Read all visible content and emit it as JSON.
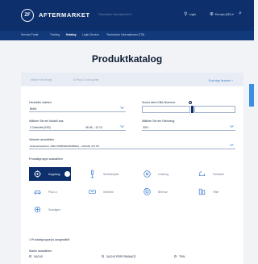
{
  "header": {
    "logo_text": "ZF",
    "brand": "AFTERMARKET",
    "dropdown": "Technische Informationen ▾",
    "login": "Login",
    "region": "Europa (DE) ▾"
  },
  "nav": {
    "items": [
      "Service-Portal",
      "Training",
      "Katalog",
      "Login-Service",
      "Technische Informationen (TIS)"
    ]
  },
  "page": {
    "title": "Produktkatalog"
  },
  "vehicle_bar": {
    "label1": "Meine Fahrzeuge",
    "label2": "⊟ Pkw & Transporter",
    "action": "Suchtyp ändern ›"
  },
  "form": {
    "manufacturer_label": "Hersteller wählen",
    "manufacturer_value": "BMW",
    "kba_label": "Suche über KBA-Nummer",
    "kba_info": "i",
    "model_label": "Wählen Sie ein Modell aus",
    "model_value": "3 Cabriolet (E93)",
    "model_years": "06.06 – 12.13",
    "vehicle_label": "Wählen Sie ein Fahrzeug",
    "vehicle_value": "330 i",
    "variant_label": "Variante auswählen",
    "variant_value": "Hinterachsantrieb, 1960 (N53B30A/N52B30A) – 200 kW, 272 PS",
    "group_label": "Produktgruppe auswählen"
  },
  "groups": [
    {
      "name": "Kupplung",
      "selected": true
    },
    {
      "name": "Stoßdämpfer",
      "selected": false
    },
    {
      "name": "Lenkung",
      "selected": false
    },
    {
      "name": "Fahrwerk",
      "selected": false
    },
    {
      "name": "Pkw-Lv",
      "selected": false
    },
    {
      "name": "Getriebe",
      "selected": false
    },
    {
      "name": "Bremse",
      "selected": false
    },
    {
      "name": "Filter",
      "selected": false
    },
    {
      "name": "Sonstiges",
      "selected": false
    }
  ],
  "summary": {
    "count_text": "1 Produktgruppe(n) ausgewählt",
    "brand_label": "Marke auswählen",
    "brands": [
      "SACHS",
      "SACHS PERFORMANCE",
      "TRW"
    ]
  },
  "colors": {
    "primary": "#0d2f6b",
    "accent": "#3c7fd1",
    "background": "#f1f3f7"
  },
  "icons": [
    "zf-logo-icon",
    "user-icon",
    "globe-icon",
    "search-icon",
    "chevron-down-icon",
    "info-icon",
    "clutch-icon",
    "shock-absorber-icon",
    "steering-icon",
    "suspension-icon",
    "car-icon",
    "gearbox-icon",
    "brake-icon",
    "filter-icon",
    "misc-icon"
  ]
}
